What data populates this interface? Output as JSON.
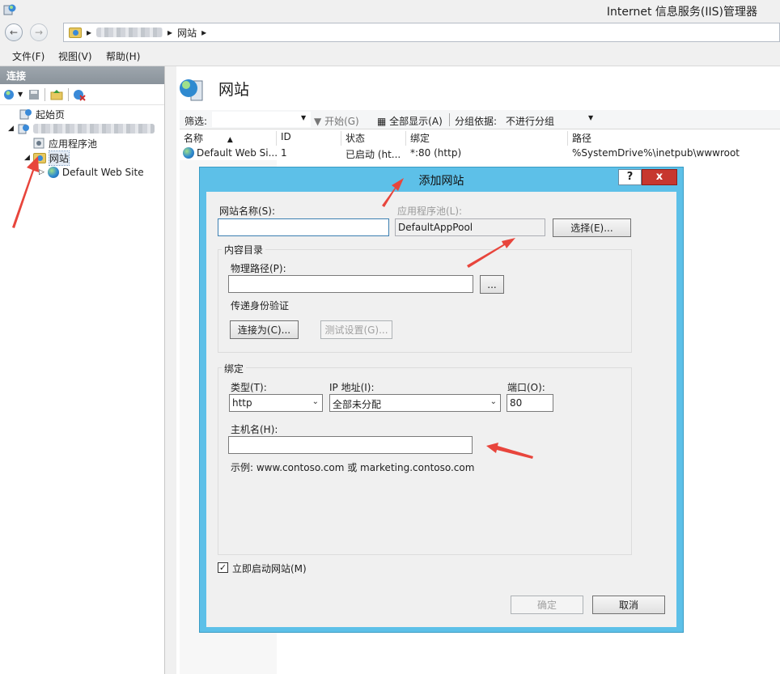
{
  "window": {
    "title": "Internet 信息服务(IIS)管理器"
  },
  "address": {
    "crumbs": [
      "网站"
    ],
    "separator": "▸"
  },
  "menu": {
    "items": [
      "文件(F)",
      "视图(V)",
      "帮助(H)"
    ]
  },
  "connections": {
    "header": "连接",
    "tree": {
      "start_page": "起始页",
      "app_pools": "应用程序池",
      "sites": "网站",
      "default_site": "Default Web Site"
    }
  },
  "main": {
    "title": "网站",
    "filter_label": "筛选:",
    "start_label": "开始(G)",
    "show_all_label": "全部显示(A)",
    "group_by_label": "分组依据:",
    "group_by_value": "不进行分组",
    "columns": [
      "名称",
      "ID",
      "状态",
      "绑定",
      "路径"
    ],
    "rows": [
      {
        "name": "Default Web Si...",
        "id": "1",
        "status": "已启动 (ht...",
        "binding": "*:80 (http)",
        "path": "%SystemDrive%\\inetpub\\wwwroot"
      }
    ]
  },
  "dialog": {
    "title": "添加网站",
    "help": "?",
    "close": "x",
    "site_name_label": "网站名称(S):",
    "site_name_value": "",
    "app_pool_label": "应用程序池(L):",
    "app_pool_value": "DefaultAppPool",
    "select_button": "选择(E)...",
    "content_group": "内容目录",
    "physical_path_label": "物理路径(P):",
    "physical_path_value": "",
    "browse_button": "...",
    "pass_auth_label": "传递身份验证",
    "connect_as_button": "连接为(C)...",
    "test_settings_button": "测试设置(G)...",
    "binding_group": "绑定",
    "type_label": "类型(T):",
    "type_value": "http",
    "ip_label": "IP 地址(I):",
    "ip_value": "全部未分配",
    "port_label": "端口(O):",
    "port_value": "80",
    "host_label": "主机名(H):",
    "host_value": "",
    "example_text": "示例: www.contoso.com 或 marketing.contoso.com",
    "start_now_label": "立即启动网站(M)",
    "start_now_checked": true,
    "ok_button": "确定",
    "cancel_button": "取消"
  },
  "colors": {
    "dialog_frame": "#5dc0e8",
    "close_button": "#c7372f",
    "annotation_arrow": "#e8453c"
  }
}
